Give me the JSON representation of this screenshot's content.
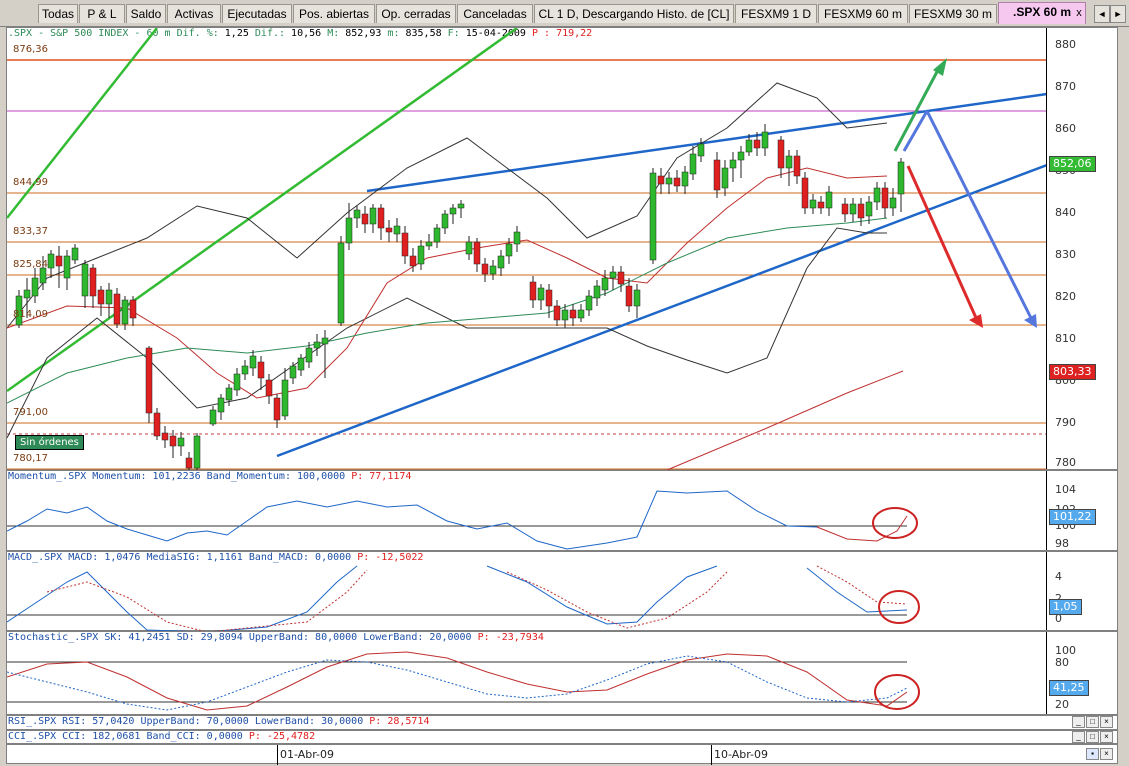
{
  "tabs": [
    {
      "label": "Todas",
      "active": false
    },
    {
      "label": "P & L",
      "active": false
    },
    {
      "label": "Saldo",
      "active": false
    },
    {
      "label": "Activas",
      "active": false
    },
    {
      "label": "Ejecutadas",
      "active": false
    },
    {
      "label": "Pos. abiertas",
      "active": false
    },
    {
      "label": "Op. cerradas",
      "active": false
    },
    {
      "label": "Canceladas",
      "active": false
    },
    {
      "label": "CL 1 D, Descargando Histo. de [CL]",
      "active": false
    },
    {
      "label": "FESXM9 1 D",
      "active": false
    },
    {
      "label": "FESXM9 60 m",
      "active": false
    },
    {
      "label": "FESXM9 30 m",
      "active": false
    },
    {
      "label": ".SPX 60 m",
      "active": true
    }
  ],
  "tab_close": "x",
  "tab_nav": [
    "◄",
    "►"
  ],
  "window_buttons": [
    "_",
    "□",
    "×"
  ],
  "main_chart": {
    "header_prefix": ".SPX - S&P 500 INDEX -  60 m",
    "header_dif_pct_label": "Dif. %:",
    "header_dif_pct": "1,25",
    "header_dif_label": "Dif.:",
    "header_dif": "10,56",
    "header_max_label": "M:",
    "header_max": "852,93",
    "header_min_label": "m:",
    "header_min": "835,58",
    "header_date_label": "F:",
    "header_date": "15-04-2009",
    "header_p_label": "P :",
    "header_p": "719,22",
    "y_ticks": [
      "880",
      "870",
      "860",
      "850",
      "840",
      "830",
      "820",
      "810",
      "800",
      "790",
      "780"
    ],
    "level_labels": [
      "876,36",
      "844,99",
      "833,37",
      "825,84",
      "814,09",
      "791,00",
      "780,17"
    ],
    "price_badge_green": "852,06",
    "price_badge_red": "803,33",
    "no_orders": "Sin órdenes",
    "colors": {
      "green_candle": "#2eb82e",
      "red_candle": "#e02020",
      "trendline": "#1e66c8",
      "level": "#d2691e",
      "magenta": "#c040c0"
    }
  },
  "momentum": {
    "header": "Momentum_.SPX Momentum: 101,2236 Band_Momentum: 100,0000",
    "p_label": "P:",
    "p": "77,1174",
    "y_ticks": [
      "104",
      "102",
      "100",
      "98"
    ],
    "badge": "101,22"
  },
  "macd": {
    "header": "MACD_.SPX MACD: 1,0476 MediaSIG: 1,1161 Band_MACD: 0,0000",
    "p_label": "P:",
    "p": "-12,5022",
    "y_ticks": [
      "4",
      "2",
      "0"
    ],
    "badge": "1,05"
  },
  "stochastic": {
    "header": "Stochastic_.SPX SK: 41,2451 SD: 29,8094 UpperBand: 80,0000 LowerBand: 20,0000",
    "p_label": "P:",
    "p": "-23,7934",
    "y_ticks": [
      "100",
      "80",
      "60",
      "20"
    ],
    "badge": "41,25"
  },
  "rsi": {
    "header": "RSI_.SPX RSI: 57,0420 UpperBand: 70,0000 LowerBand: 30,0000",
    "p_label": "P:",
    "p": "28,5714"
  },
  "cci": {
    "header": "CCI_.SPX CCI: 182,0681 Band_CCI: 0,0000",
    "p_label": "P:",
    "p": "-25,4782"
  },
  "x_axis": {
    "labels": [
      "01-Abr-09",
      "10-Abr-09"
    ]
  }
}
